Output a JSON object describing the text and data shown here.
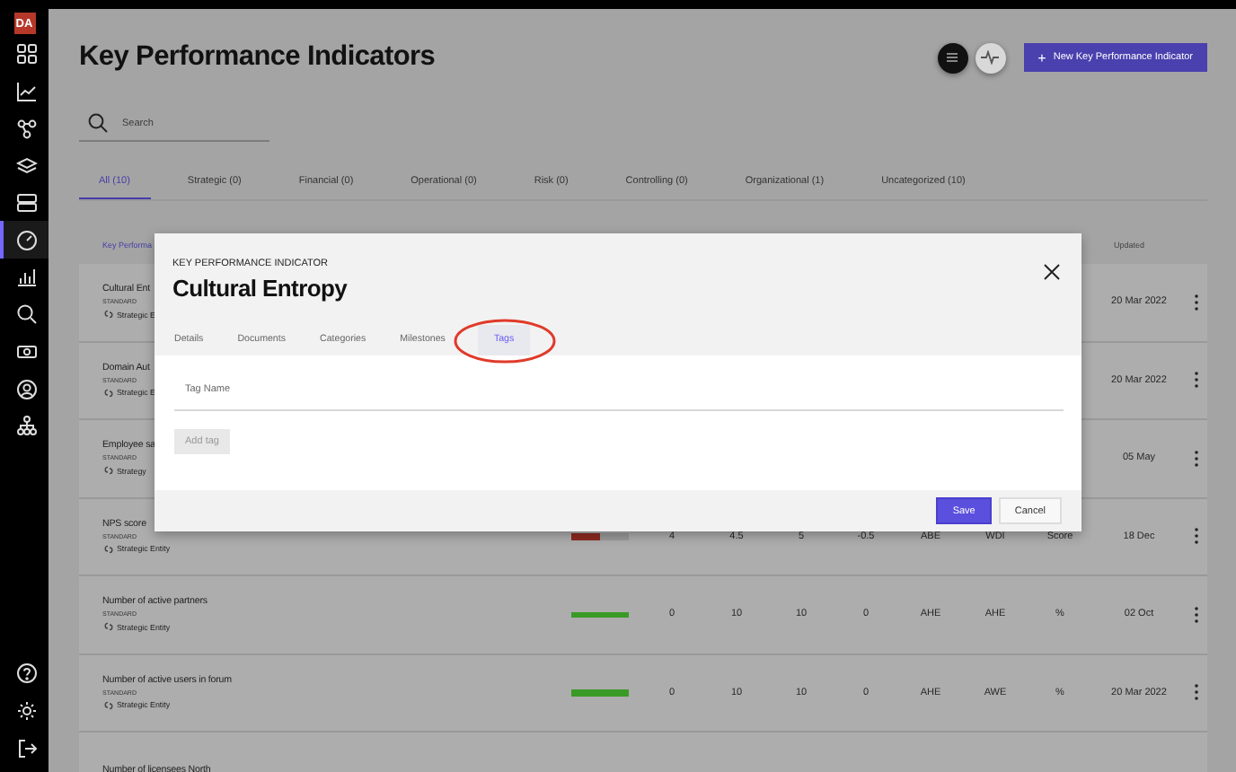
{
  "sidebar": {
    "logo": "DA",
    "items": [
      {
        "kind": "grid",
        "selected": false
      },
      {
        "kind": "line-chart",
        "selected": false
      },
      {
        "kind": "nodes",
        "selected": false
      },
      {
        "kind": "layers",
        "selected": false
      },
      {
        "kind": "cards",
        "selected": false
      },
      {
        "kind": "gauge",
        "selected": true
      },
      {
        "kind": "bar-chart",
        "selected": false
      },
      {
        "kind": "zoom",
        "selected": false
      },
      {
        "kind": "money",
        "selected": false
      },
      {
        "kind": "user",
        "selected": false
      },
      {
        "kind": "hierarchy",
        "selected": false
      }
    ],
    "bottom_items": [
      {
        "kind": "help",
        "selected": false
      },
      {
        "kind": "settings",
        "selected": false
      },
      {
        "kind": "logout",
        "selected": false
      }
    ]
  },
  "page": {
    "title": "Key Performance Indicators",
    "new_button": {
      "icon": "+",
      "label": "New Key Performance Indicator"
    }
  },
  "search": {
    "placeholder": "Search"
  },
  "tabs": [
    {
      "label": "All (10)",
      "selected": true
    },
    {
      "label": "Strategic (0)",
      "selected": false
    },
    {
      "label": "Financial (0)",
      "selected": false
    },
    {
      "label": "Operational (0)",
      "selected": false
    },
    {
      "label": "Risk (0)",
      "selected": false
    },
    {
      "label": "Controlling (0)",
      "selected": false
    },
    {
      "label": "Organizational (1)",
      "selected": false
    },
    {
      "label": "Uncategorized (10)",
      "selected": false
    }
  ],
  "table": {
    "columns": [
      "Key Performa",
      "Updated"
    ],
    "rows": [
      {
        "name": "Cultural Ent",
        "type": "STANDARD",
        "entity": "Strategic E",
        "updated": "20 Mar 2022"
      },
      {
        "name": "Domain Aut",
        "type": "STANDARD",
        "entity": "Strategic E",
        "updated": "20 Mar 2022"
      },
      {
        "name": "Employee sa",
        "type": "STANDARD",
        "entity": "Strategy",
        "updated": "05 May"
      },
      {
        "name": "NPS score",
        "type": "STANDARD",
        "entity": "Strategic Entity",
        "bar": {
          "level": 0.5,
          "color": "#8c2a22"
        },
        "values": [
          "4",
          "4.5",
          "5",
          "-0.5",
          "ABE",
          "WDI",
          "Score"
        ],
        "updated": "18 Dec"
      },
      {
        "name": "Number of active partners",
        "type": "STANDARD",
        "entity": "Strategic Entity",
        "bar": {
          "level": 1,
          "color": "#3a9a26"
        },
        "values": [
          "0",
          "10",
          "10",
          "0",
          "AHE",
          "AHE",
          "%"
        ],
        "updated": "02 Oct"
      },
      {
        "name": "Number of active users in forum",
        "type": "STANDARD",
        "entity": "Strategic Entity",
        "bar": {
          "level": 1,
          "color": "#3a9a26"
        },
        "values": [
          "0",
          "10",
          "10",
          "0",
          "AHE",
          "AWE",
          "%"
        ],
        "updated": "20 Mar 2022"
      },
      {
        "name": "Number of licensees North"
      }
    ]
  },
  "modal": {
    "eyebrow": "KEY PERFORMANCE INDICATOR",
    "title": "Cultural Entropy",
    "tabs": [
      {
        "label": "Details",
        "selected": false,
        "highlighted": false
      },
      {
        "label": "Documents",
        "selected": false,
        "highlighted": false
      },
      {
        "label": "Categories",
        "selected": false,
        "highlighted": false
      },
      {
        "label": "Milestones",
        "selected": false,
        "highlighted": false
      },
      {
        "label": "Tags",
        "selected": true,
        "highlighted": true
      }
    ],
    "field": {
      "placeholder": "Tag Name"
    },
    "add_button": {
      "label": "Add tag",
      "disabled": true
    },
    "buttons": [
      {
        "label": "Save",
        "kind": "primary"
      },
      {
        "label": "Cancel",
        "kind": "secondary"
      }
    ]
  }
}
